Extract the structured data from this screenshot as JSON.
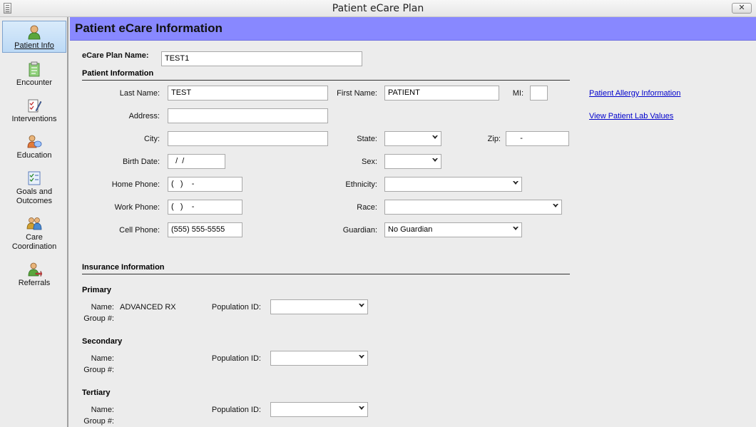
{
  "window": {
    "title": "Patient eCare Plan",
    "close_label": "✕"
  },
  "sidebar": {
    "items": [
      {
        "label": "Patient Info"
      },
      {
        "label": "Encounter"
      },
      {
        "label": "Interventions"
      },
      {
        "label": "Education"
      },
      {
        "label": "Goals and",
        "label2": "Outcomes"
      },
      {
        "label": "Care",
        "label2": "Coordination"
      },
      {
        "label": "Referrals"
      }
    ]
  },
  "header": {
    "title": "Patient eCare Information"
  },
  "plan": {
    "name_label": "eCare Plan Name:",
    "name_value": "TEST1"
  },
  "patient": {
    "section_title": "Patient Information",
    "last_name_label": "Last Name:",
    "last_name": "TEST",
    "first_name_label": "First Name:",
    "first_name": "PATIENT",
    "mi_label": "MI:",
    "mi": "",
    "address_label": "Address:",
    "address": "",
    "city_label": "City:",
    "city": "",
    "state_label": "State:",
    "state": "",
    "zip_label": "Zip:",
    "zip": "     -",
    "birth_date_label": "Birth Date:",
    "birth_date": "  /  /",
    "sex_label": "Sex:",
    "sex": "",
    "home_phone_label": "Home Phone:",
    "home_phone": "(   )    -",
    "ethnicity_label": "Ethnicity:",
    "ethnicity": "",
    "work_phone_label": "Work Phone:",
    "work_phone": "(   )    -",
    "race_label": "Race:",
    "race": "",
    "cell_phone_label": "Cell Phone:",
    "cell_phone": "(555) 555-5555",
    "guardian_label": "Guardian:",
    "guardian": "No Guardian"
  },
  "links": {
    "allergy": "Patient Allergy Information",
    "lab": "View Patient Lab Values"
  },
  "insurance": {
    "section_title": "Insurance Information",
    "name_label": "Name:",
    "group_label": "Group #:",
    "population_label": "Population ID:",
    "primary": {
      "title": "Primary",
      "name": "ADVANCED RX",
      "group": "",
      "population": ""
    },
    "secondary": {
      "title": "Secondary",
      "name": "",
      "group": "",
      "population": ""
    },
    "tertiary": {
      "title": "Tertiary",
      "name": "",
      "group": "",
      "population": ""
    }
  },
  "colors": {
    "header_band": "#8888ff",
    "active_nav": "#bcd9f5",
    "link": "#0000cc"
  }
}
